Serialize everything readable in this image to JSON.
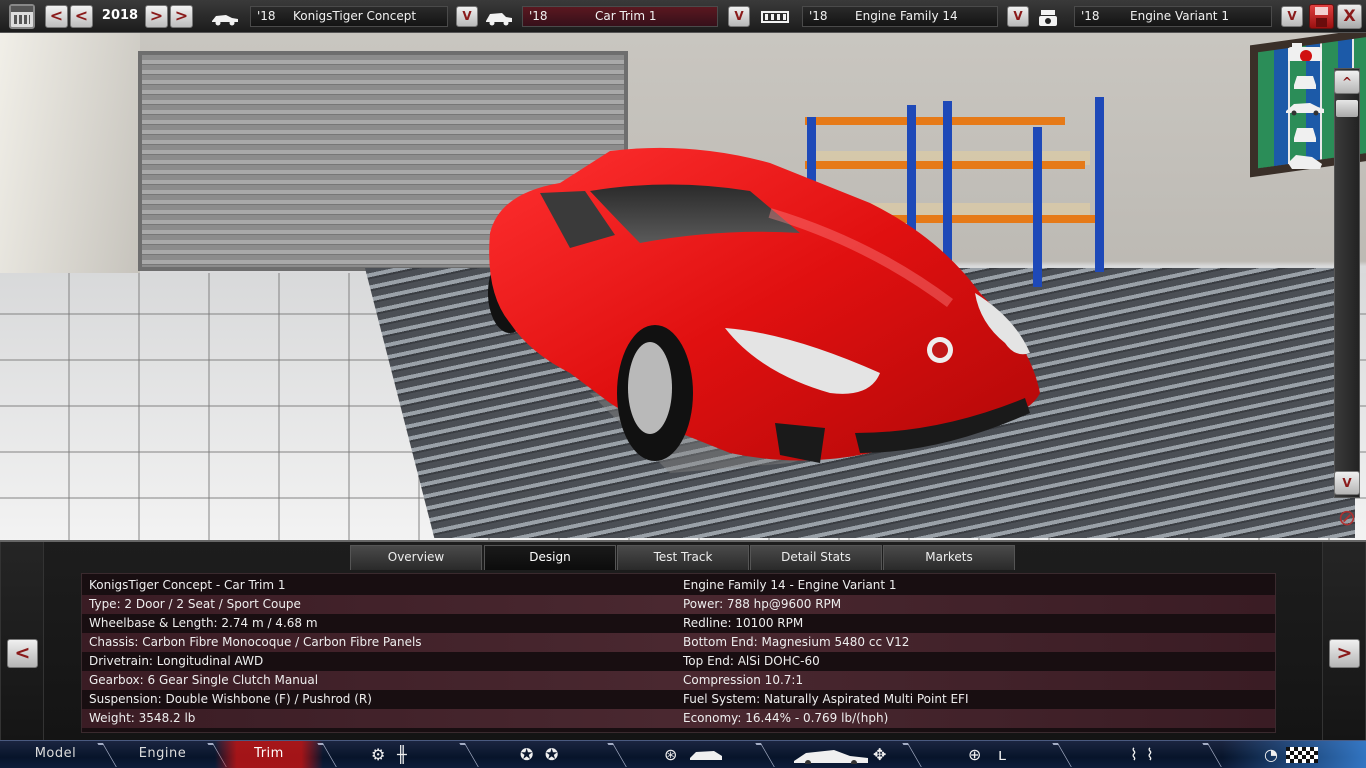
{
  "topbar": {
    "year": "2018",
    "prev2_label": "<",
    "prev_label": "<",
    "next_label": ">",
    "next2_label": ">",
    "selectors": [
      {
        "icon": "car-model-icon",
        "year": "'18",
        "name": "KonigsTiger Concept",
        "dropdown": "V"
      },
      {
        "icon": "car-trim-icon",
        "year": "'18",
        "name": "Car Trim 1",
        "dropdown": "V"
      },
      {
        "icon": "engine-family-icon",
        "year": "'18",
        "name": "Engine Family 14",
        "dropdown": "V"
      },
      {
        "icon": "engine-variant-icon",
        "year": "'18",
        "name": "Engine Variant 1",
        "dropdown": "V"
      }
    ],
    "close_label": "X"
  },
  "viewport": {
    "scroll_up": "^",
    "scroll_down": "V",
    "view_icons": [
      "camera-icon",
      "car-front-view-icon",
      "car-side-view-icon",
      "car-rear-view-icon",
      "car-angle-view-icon"
    ]
  },
  "panel": {
    "left_arrow": "<",
    "right_arrow": ">",
    "tabs": [
      "Overview",
      "Design",
      "Test Track",
      "Detail Stats",
      "Markets"
    ],
    "active_tab": "Design",
    "rows": [
      {
        "left": "KonigsTiger Concept - Car Trim 1",
        "right": "Engine Family 14 - Engine Variant 1"
      },
      {
        "left": "Type: 2 Door / 2 Seat / Sport Coupe",
        "right": "Power: 788 hp@9600 RPM"
      },
      {
        "left": "Wheelbase & Length: 2.74 m / 4.68 m",
        "right": "Redline: 10100 RPM"
      },
      {
        "left": "Chassis: Carbon Fibre Monocoque / Carbon Fibre Panels",
        "right": "Bottom End: Magnesium 5480 cc V12"
      },
      {
        "left": "Drivetrain: Longitudinal AWD",
        "right": "Top End: AlSi DOHC-60"
      },
      {
        "left": "Gearbox: 6 Gear Single Clutch Manual",
        "right": "Compression 10.7:1"
      },
      {
        "left": "Suspension: Double Wishbone (F) / Pushrod (R)",
        "right": "Fuel System: Naturally Aspirated Multi Point EFI"
      },
      {
        "left": "Weight: 3548.2 lb",
        "right": "Economy: 16.44% - 0.769 lb/(hph)"
      }
    ]
  },
  "bottom_nav": {
    "segments": [
      "Model",
      "Engine",
      "Trim"
    ],
    "active_segment": "Trim",
    "icons": [
      "gear-icon",
      "gearbox-icon",
      "wheel-icon",
      "brake-icon",
      "chassis-icon",
      "car-body-icon",
      "fan-icon",
      "steering-wheel-icon",
      "seat-icon",
      "suspension-icon",
      "gauge-icon",
      "finish-flag-icon"
    ]
  },
  "colors": {
    "car": "#e01010",
    "accent_red": "#8a1a1a",
    "nav_blue": "#07142a",
    "active_nav_red": "#be1414"
  }
}
